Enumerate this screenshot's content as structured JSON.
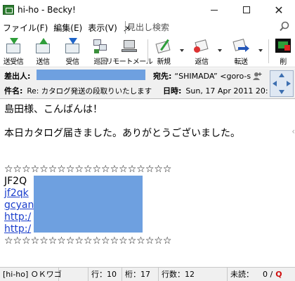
{
  "window": {
    "title": "hi-ho - Becky!",
    "min_label": "",
    "max_label": "",
    "close_label": "✕"
  },
  "menu": {
    "items": [
      "ファイル(F)",
      "編集(E)",
      "表示(V)",
      "メ"
    ],
    "search_placeholder": "見出し検索"
  },
  "toolbar": {
    "buttons": [
      {
        "label": "送受信",
        "icon": "send-receive-icon"
      },
      {
        "label": "送信",
        "icon": "send-icon"
      },
      {
        "label": "受信",
        "icon": "receive-icon"
      },
      {
        "label": "巡回",
        "icon": "patrol-icon"
      },
      {
        "label": "リモートメール",
        "icon": "remote-mail-icon"
      },
      {
        "label": "新規",
        "icon": "new-mail-icon"
      },
      {
        "label": "返信",
        "icon": "reply-icon"
      },
      {
        "label": "転送",
        "icon": "forward-icon"
      },
      {
        "label": "削",
        "icon": "delete-icon"
      }
    ]
  },
  "header": {
    "from_label": "差出人:",
    "to_label": "宛先:",
    "to_value": "“SHIMADA” <goro-s",
    "subject_label": "件名:",
    "subject_value": "Re: カタログ発送の段取りいたします",
    "date_label": "日時:",
    "date_value": "Sun, 17 Apr 2011 20:"
  },
  "body": {
    "line1": "島田様、こんばんは！",
    "line2": "本日カタログ届きました。ありがとうございました。",
    "stars1": "☆☆☆☆☆☆☆☆☆☆☆☆☆☆☆☆☆☆☆",
    "sig1": "JF2Q",
    "sig2": "jf2qk",
    "sig3": "gcyan",
    "sig4": "http:/",
    "sig5": "http:/",
    "stars2": "☆☆☆☆☆☆☆☆☆☆☆☆☆☆☆☆☆☆☆",
    "scroll_hint": "‹"
  },
  "status": {
    "mailbox": "[hi-ho]",
    "folder": "ＯＫワゴ",
    "row": "行：10",
    "col": "桁：17",
    "lines": "行数：12",
    "unread": "未読：",
    "unread_count": "0 /",
    "q": "Q"
  },
  "colors": {
    "redaction": "#6ea0e0",
    "link": "#1a3ecc",
    "status_q": "#d01010"
  }
}
